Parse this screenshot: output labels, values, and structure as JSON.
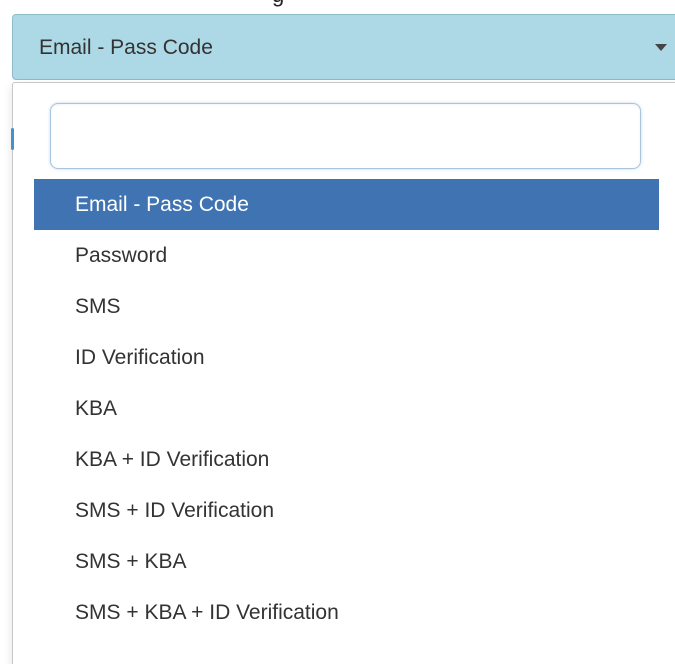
{
  "header": {
    "fragment_text": "g"
  },
  "select": {
    "value": "Email - Pass Code",
    "caret_icon": "caret-down-icon"
  },
  "search": {
    "value": "",
    "placeholder": ""
  },
  "options": [
    {
      "label": "Email - Pass Code",
      "selected": true
    },
    {
      "label": "Password",
      "selected": false
    },
    {
      "label": "SMS",
      "selected": false
    },
    {
      "label": "ID Verification",
      "selected": false
    },
    {
      "label": "KBA",
      "selected": false
    },
    {
      "label": "KBA + ID Verification",
      "selected": false
    },
    {
      "label": "SMS + ID Verification",
      "selected": false
    },
    {
      "label": "SMS + KBA",
      "selected": false
    },
    {
      "label": "SMS + KBA + ID Verification",
      "selected": false
    }
  ],
  "colors": {
    "select_background": "#add8e6",
    "highlight": "#3f73b1",
    "highlight_text": "#ffffff"
  }
}
